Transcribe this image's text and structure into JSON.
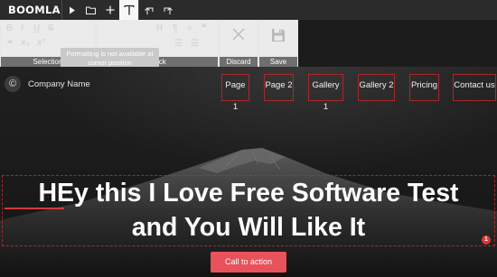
{
  "editor": {
    "logo": "BOOMLA",
    "toolbar": [
      {
        "name": "play-icon",
        "active": false
      },
      {
        "name": "folder-icon",
        "active": false
      },
      {
        "name": "plus-icon",
        "active": false
      },
      {
        "name": "text-icon",
        "active": true
      },
      {
        "name": "undo-icon",
        "active": false
      },
      {
        "name": "redo-icon",
        "active": false
      }
    ],
    "format_panel": {
      "tooltip": "Formatting is not available at cursor position",
      "groups": {
        "selection": "Selection",
        "block": "Block",
        "discard": "Discard",
        "save": "Save"
      }
    }
  },
  "site": {
    "brand_mark": "©",
    "company_name": "Company Name",
    "nav": [
      "Page 1",
      "Page 2",
      "Gallery 1",
      "Gallery 2",
      "Pricing",
      "Contact us"
    ],
    "hero": {
      "line1": "HEy this I Love Free Software Test",
      "line2": "and You Will Like It"
    },
    "badge": "1",
    "cta": "Call to action"
  },
  "colors": {
    "accent": "#e9525a",
    "outline": "#c82828",
    "toolbar_bg": "#2b2b2b",
    "panel_label_bg": "#6f6f6f"
  }
}
